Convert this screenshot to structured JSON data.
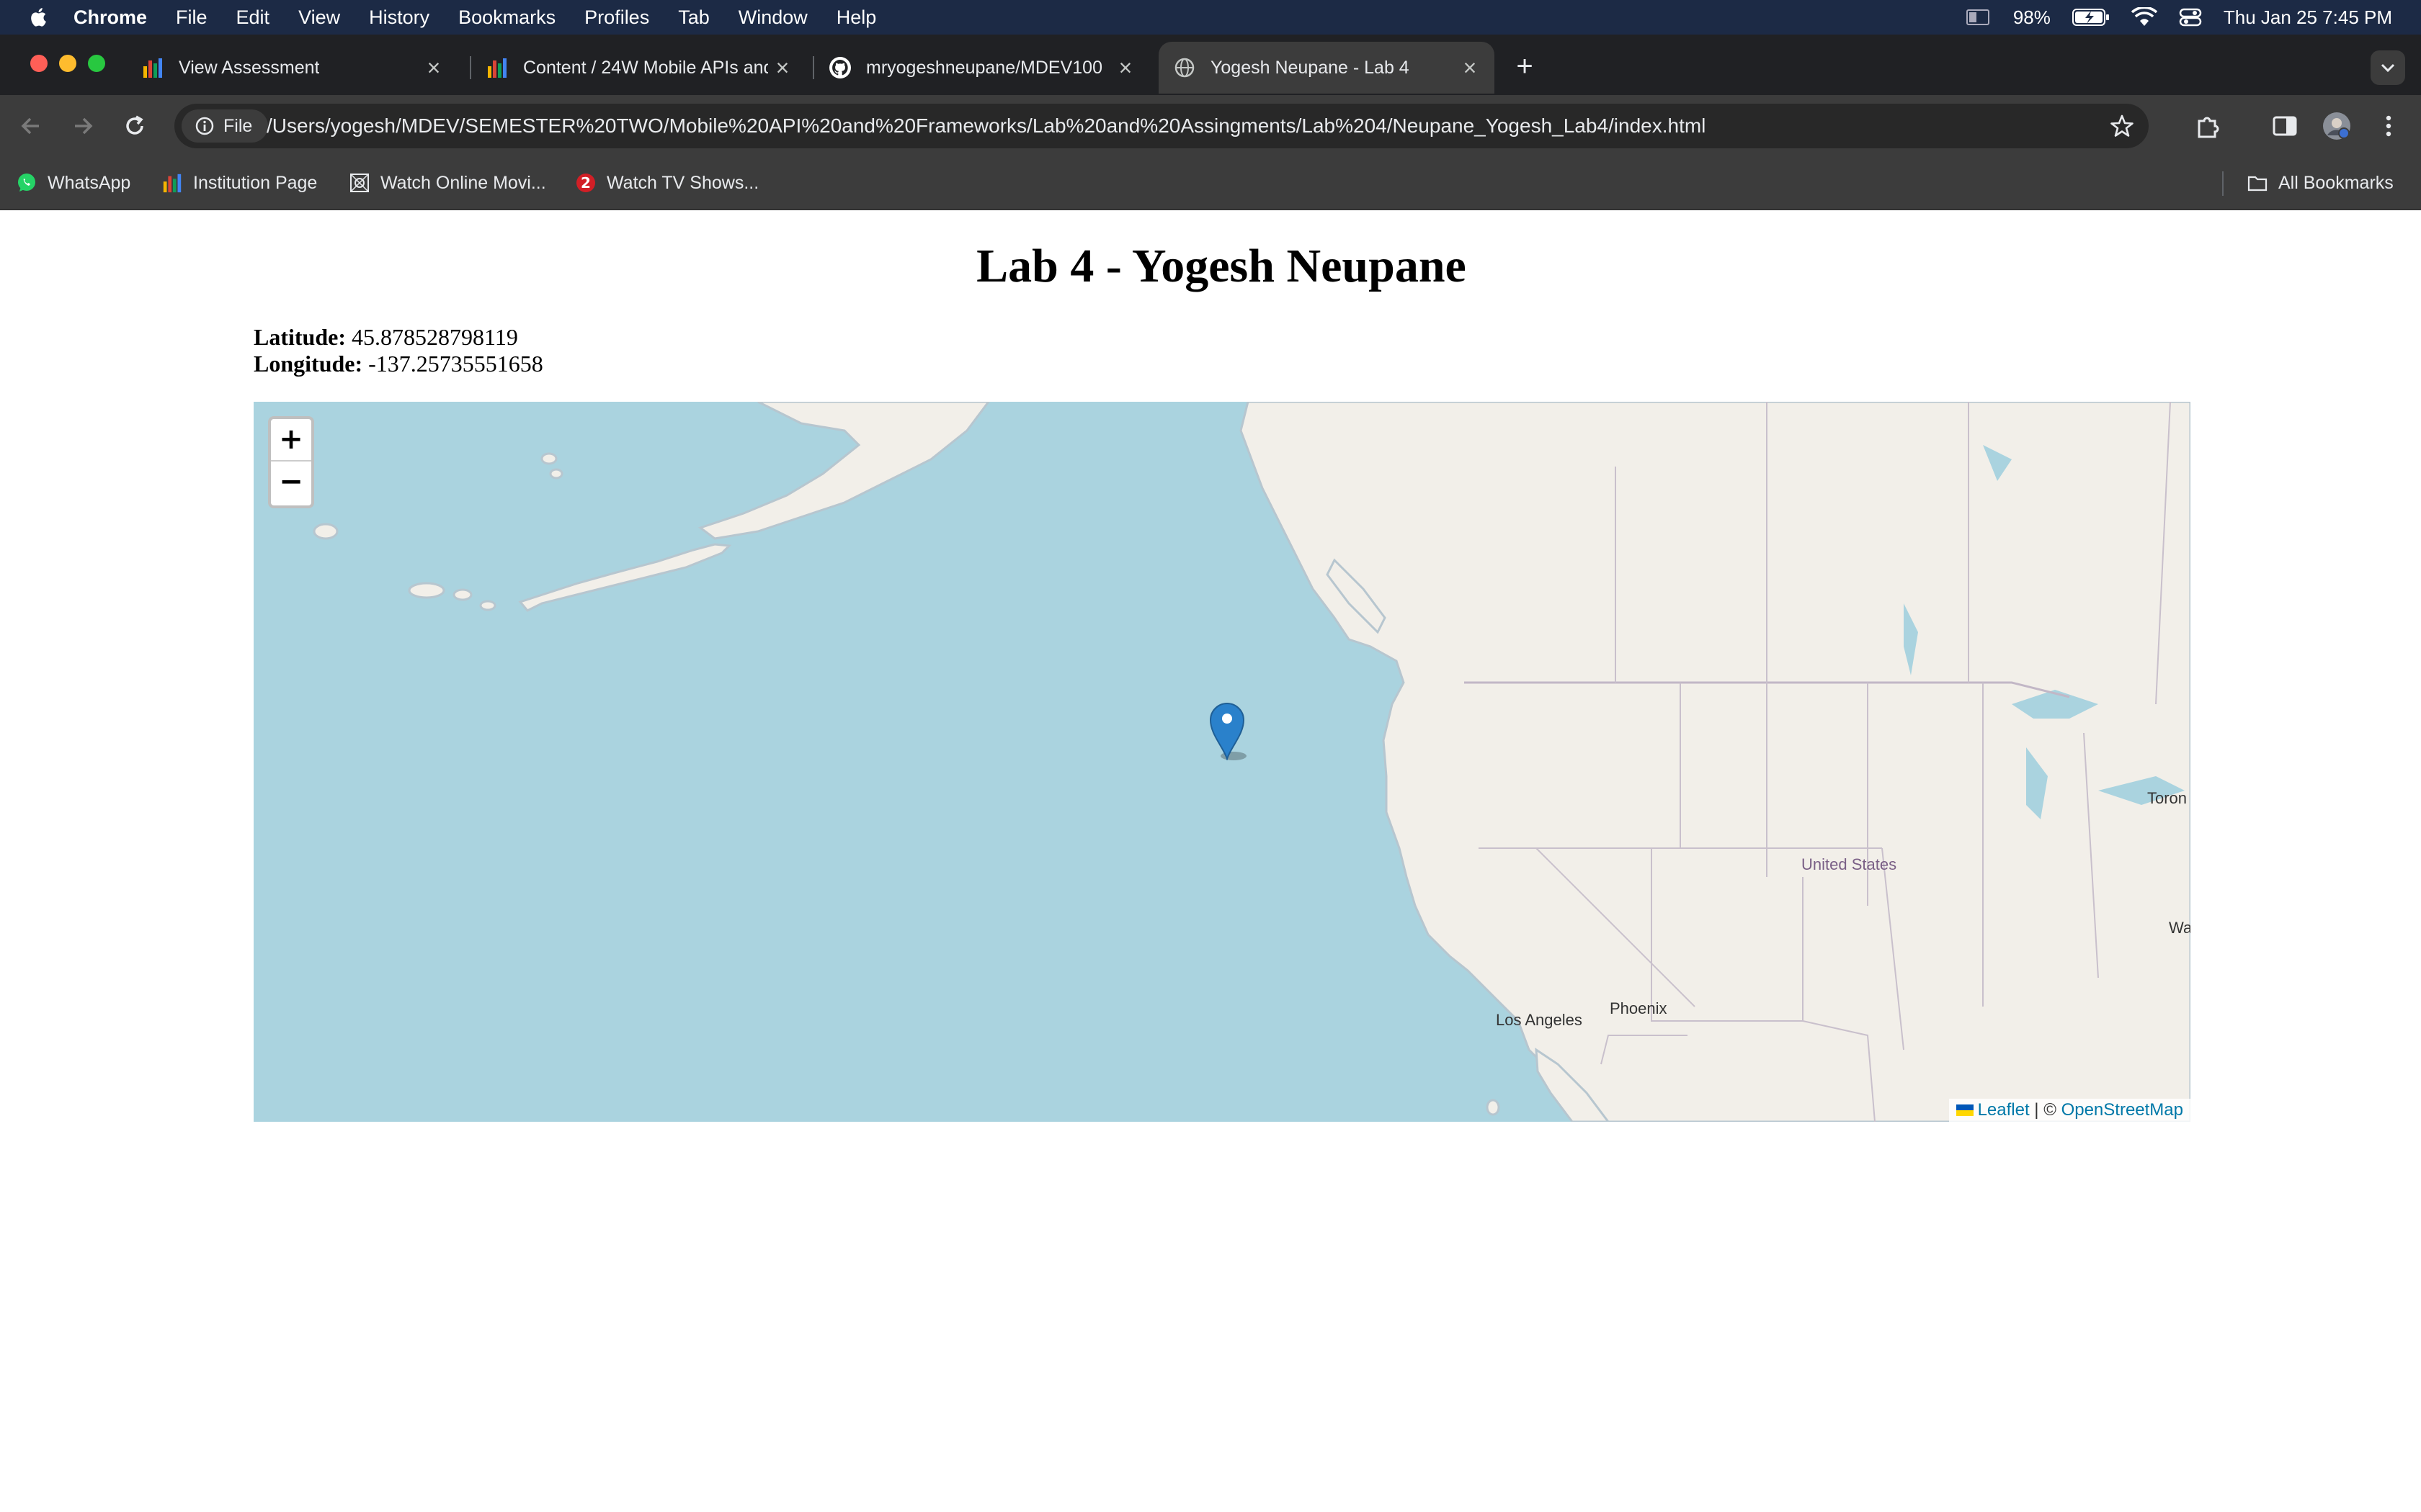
{
  "menubar": {
    "app_name": "Chrome",
    "menus": [
      "File",
      "Edit",
      "View",
      "History",
      "Bookmarks",
      "Profiles",
      "Tab",
      "Window",
      "Help"
    ],
    "battery": "98%",
    "datetime": "Thu Jan 25  7:45 PM"
  },
  "tabs": [
    {
      "title": "View Assessment",
      "icon": "d2l-bars-icon"
    },
    {
      "title": "Content / 24W Mobile APIs and",
      "icon": "d2l-bars-icon"
    },
    {
      "title": "mryogeshneupane/MDEV100",
      "icon": "github-icon"
    },
    {
      "title": "Yogesh Neupane - Lab 4",
      "icon": "globe-icon",
      "active": true
    }
  ],
  "omnibox": {
    "chip_label": "File",
    "url": "/Users/yogesh/MDEV/SEMESTER%20TWO/Mobile%20API%20and%20Frameworks/Lab%20and%20Assingments/Lab%204/Neupane_Yogesh_Lab4/index.html"
  },
  "bookmarks": {
    "items": [
      "WhatsApp",
      "Institution Page",
      "Watch Online Movi...",
      "Watch TV Shows..."
    ],
    "all_bookmarks": "All Bookmarks"
  },
  "page": {
    "heading": "Lab 4 - Yogesh Neupane",
    "latitude_label": "Latitude:",
    "latitude_value": "45.878528798119",
    "longitude_label": "Longitude:",
    "longitude_value": "-137.25735551658"
  },
  "map": {
    "zoom_in": "+",
    "zoom_out": "−",
    "labels": {
      "united_states": "United States",
      "phoenix": "Phoenix",
      "los_angeles": "Los Angeles",
      "toronto_partial": "Toron",
      "wa_partial": "Wa"
    },
    "attribution": {
      "leaflet": "Leaflet",
      "separator": " | © ",
      "osm": "OpenStreetMap"
    },
    "colors": {
      "water": "#aad3df",
      "land": "#f2efe9",
      "marker": "#2a81cb"
    }
  }
}
